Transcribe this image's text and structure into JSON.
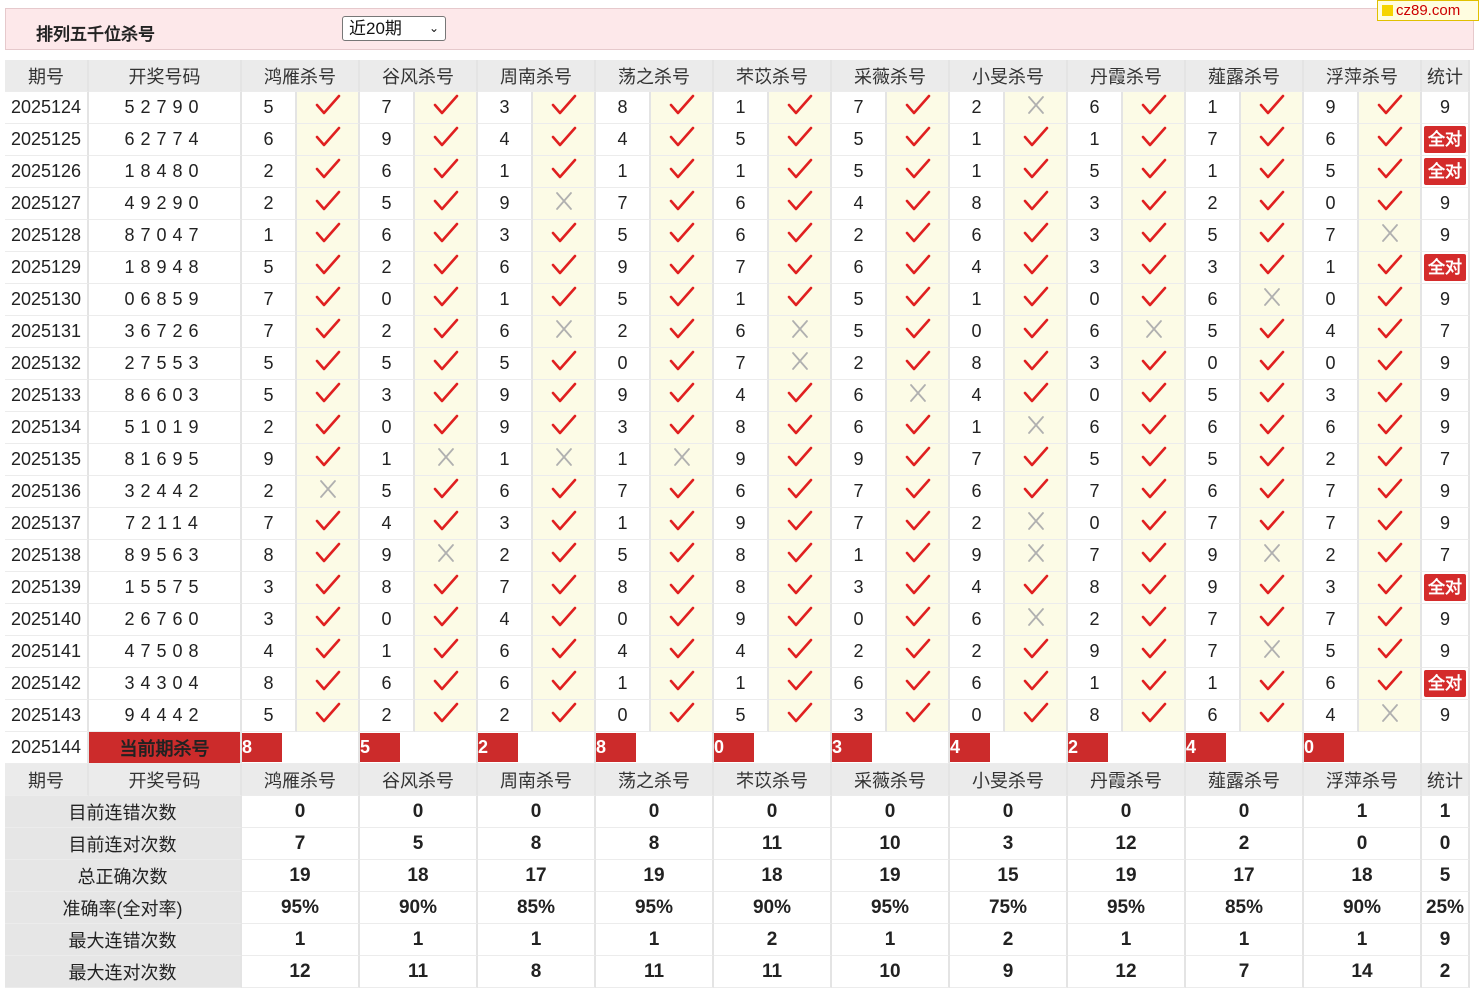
{
  "header": {
    "title": "排列五千位杀号",
    "select_value": "近20期",
    "logo_text": "cz89.com"
  },
  "columns": {
    "period": "期号",
    "draw": "开奖号码",
    "experts": [
      "鸿雁杀号",
      "谷风杀号",
      "周南杀号",
      "荡之杀号",
      "芣苡杀号",
      "采薇杀号",
      "小旻杀号",
      "丹霞杀号",
      "薤露杀号",
      "浮萍杀号"
    ],
    "stat": "统计"
  },
  "rows": [
    {
      "period": "2025124",
      "draw": "52790",
      "picks": [
        "5",
        "7",
        "3",
        "8",
        "1",
        "7",
        "2",
        "6",
        "1",
        "9"
      ],
      "hits": [
        1,
        1,
        1,
        1,
        1,
        1,
        0,
        1,
        1,
        1
      ],
      "stat": "9"
    },
    {
      "period": "2025125",
      "draw": "62774",
      "picks": [
        "6",
        "9",
        "4",
        "4",
        "5",
        "5",
        "1",
        "1",
        "7",
        "6"
      ],
      "hits": [
        1,
        1,
        1,
        1,
        1,
        1,
        1,
        1,
        1,
        1
      ],
      "stat": "全对"
    },
    {
      "period": "2025126",
      "draw": "18480",
      "picks": [
        "2",
        "6",
        "1",
        "1",
        "1",
        "5",
        "1",
        "5",
        "1",
        "5"
      ],
      "hits": [
        1,
        1,
        1,
        1,
        1,
        1,
        1,
        1,
        1,
        1
      ],
      "stat": "全对"
    },
    {
      "period": "2025127",
      "draw": "49290",
      "picks": [
        "2",
        "5",
        "9",
        "7",
        "6",
        "4",
        "8",
        "3",
        "2",
        "0"
      ],
      "hits": [
        1,
        1,
        0,
        1,
        1,
        1,
        1,
        1,
        1,
        1
      ],
      "stat": "9"
    },
    {
      "period": "2025128",
      "draw": "87047",
      "picks": [
        "1",
        "6",
        "3",
        "5",
        "6",
        "2",
        "6",
        "3",
        "5",
        "7"
      ],
      "hits": [
        1,
        1,
        1,
        1,
        1,
        1,
        1,
        1,
        1,
        0
      ],
      "stat": "9"
    },
    {
      "period": "2025129",
      "draw": "18948",
      "picks": [
        "5",
        "2",
        "6",
        "9",
        "7",
        "6",
        "4",
        "3",
        "3",
        "1"
      ],
      "hits": [
        1,
        1,
        1,
        1,
        1,
        1,
        1,
        1,
        1,
        1
      ],
      "stat": "全对"
    },
    {
      "period": "2025130",
      "draw": "06859",
      "picks": [
        "7",
        "0",
        "1",
        "5",
        "1",
        "5",
        "1",
        "0",
        "6",
        "0"
      ],
      "hits": [
        1,
        1,
        1,
        1,
        1,
        1,
        1,
        1,
        0,
        1
      ],
      "stat": "9"
    },
    {
      "period": "2025131",
      "draw": "36726",
      "picks": [
        "7",
        "2",
        "6",
        "2",
        "6",
        "5",
        "0",
        "6",
        "5",
        "4"
      ],
      "hits": [
        1,
        1,
        0,
        1,
        0,
        1,
        1,
        0,
        1,
        1
      ],
      "stat": "7"
    },
    {
      "period": "2025132",
      "draw": "27553",
      "picks": [
        "5",
        "5",
        "5",
        "0",
        "7",
        "2",
        "8",
        "3",
        "0",
        "0"
      ],
      "hits": [
        1,
        1,
        1,
        1,
        0,
        1,
        1,
        1,
        1,
        1
      ],
      "stat": "9"
    },
    {
      "period": "2025133",
      "draw": "86603",
      "picks": [
        "5",
        "3",
        "9",
        "9",
        "4",
        "6",
        "4",
        "0",
        "5",
        "3"
      ],
      "hits": [
        1,
        1,
        1,
        1,
        1,
        0,
        1,
        1,
        1,
        1
      ],
      "stat": "9"
    },
    {
      "period": "2025134",
      "draw": "51019",
      "picks": [
        "2",
        "0",
        "9",
        "3",
        "8",
        "6",
        "1",
        "6",
        "6",
        "6"
      ],
      "hits": [
        1,
        1,
        1,
        1,
        1,
        1,
        0,
        1,
        1,
        1
      ],
      "stat": "9"
    },
    {
      "period": "2025135",
      "draw": "81695",
      "picks": [
        "9",
        "1",
        "1",
        "1",
        "9",
        "9",
        "7",
        "5",
        "5",
        "2"
      ],
      "hits": [
        1,
        0,
        0,
        0,
        1,
        1,
        1,
        1,
        1,
        1
      ],
      "stat": "7"
    },
    {
      "period": "2025136",
      "draw": "32442",
      "picks": [
        "2",
        "5",
        "6",
        "7",
        "6",
        "7",
        "6",
        "7",
        "6",
        "7"
      ],
      "hits": [
        0,
        1,
        1,
        1,
        1,
        1,
        1,
        1,
        1,
        1
      ],
      "stat": "9"
    },
    {
      "period": "2025137",
      "draw": "72114",
      "picks": [
        "7",
        "4",
        "3",
        "1",
        "9",
        "7",
        "2",
        "0",
        "7",
        "7"
      ],
      "hits": [
        1,
        1,
        1,
        1,
        1,
        1,
        0,
        1,
        1,
        1
      ],
      "stat": "9"
    },
    {
      "period": "2025138",
      "draw": "89563",
      "picks": [
        "8",
        "9",
        "2",
        "5",
        "8",
        "1",
        "9",
        "7",
        "9",
        "2"
      ],
      "hits": [
        1,
        0,
        1,
        1,
        1,
        1,
        0,
        1,
        0,
        1
      ],
      "stat": "7"
    },
    {
      "period": "2025139",
      "draw": "15575",
      "picks": [
        "3",
        "8",
        "7",
        "8",
        "8",
        "3",
        "4",
        "8",
        "9",
        "3"
      ],
      "hits": [
        1,
        1,
        1,
        1,
        1,
        1,
        1,
        1,
        1,
        1
      ],
      "stat": "全对"
    },
    {
      "period": "2025140",
      "draw": "26760",
      "picks": [
        "3",
        "0",
        "4",
        "0",
        "9",
        "0",
        "6",
        "2",
        "7",
        "7"
      ],
      "hits": [
        1,
        1,
        1,
        1,
        1,
        1,
        0,
        1,
        1,
        1
      ],
      "stat": "9"
    },
    {
      "period": "2025141",
      "draw": "47508",
      "picks": [
        "4",
        "1",
        "6",
        "4",
        "4",
        "2",
        "2",
        "9",
        "7",
        "5"
      ],
      "hits": [
        1,
        1,
        1,
        1,
        1,
        1,
        1,
        1,
        0,
        1
      ],
      "stat": "9"
    },
    {
      "period": "2025142",
      "draw": "34304",
      "picks": [
        "8",
        "6",
        "6",
        "1",
        "1",
        "6",
        "6",
        "1",
        "1",
        "6"
      ],
      "hits": [
        1,
        1,
        1,
        1,
        1,
        1,
        1,
        1,
        1,
        1
      ],
      "stat": "全对"
    },
    {
      "period": "2025143",
      "draw": "94442",
      "picks": [
        "5",
        "2",
        "2",
        "0",
        "5",
        "3",
        "0",
        "8",
        "6",
        "4"
      ],
      "hits": [
        1,
        1,
        1,
        1,
        1,
        1,
        1,
        1,
        1,
        0
      ],
      "stat": "9"
    }
  ],
  "current": {
    "period": "2025144",
    "label": "当前期杀号",
    "picks": [
      "8",
      "5",
      "2",
      "8",
      "0",
      "3",
      "4",
      "2",
      "4",
      "0"
    ]
  },
  "summary": [
    {
      "label": "目前连错次数",
      "values": [
        "0",
        "0",
        "0",
        "0",
        "0",
        "0",
        "0",
        "0",
        "0",
        "1"
      ],
      "stat": "1",
      "color": "blue"
    },
    {
      "label": "目前连对次数",
      "values": [
        "7",
        "5",
        "8",
        "8",
        "11",
        "10",
        "3",
        "12",
        "2",
        "0"
      ],
      "stat": "0",
      "color": "blue"
    },
    {
      "label": "总正确次数",
      "values": [
        "19",
        "18",
        "17",
        "19",
        "18",
        "19",
        "15",
        "19",
        "17",
        "18"
      ],
      "stat": "5",
      "color": "blue"
    },
    {
      "label": "准确率(全对率)",
      "values": [
        "95%",
        "90%",
        "85%",
        "95%",
        "90%",
        "95%",
        "75%",
        "95%",
        "85%",
        "90%"
      ],
      "stat": "25%",
      "color": "red"
    },
    {
      "label": "最大连错次数",
      "values": [
        "1",
        "1",
        "1",
        "1",
        "2",
        "1",
        "2",
        "1",
        "1",
        "1"
      ],
      "stat": "9",
      "color": "blue"
    },
    {
      "label": "最大连对次数",
      "values": [
        "12",
        "11",
        "8",
        "11",
        "11",
        "10",
        "9",
        "12",
        "7",
        "14"
      ],
      "stat": "2",
      "color": "blue"
    }
  ],
  "colors": {
    "check": "#e02020",
    "cross": "#b0b0b0",
    "accent": "#cc2b2b",
    "blue": "#1a1ad0"
  }
}
